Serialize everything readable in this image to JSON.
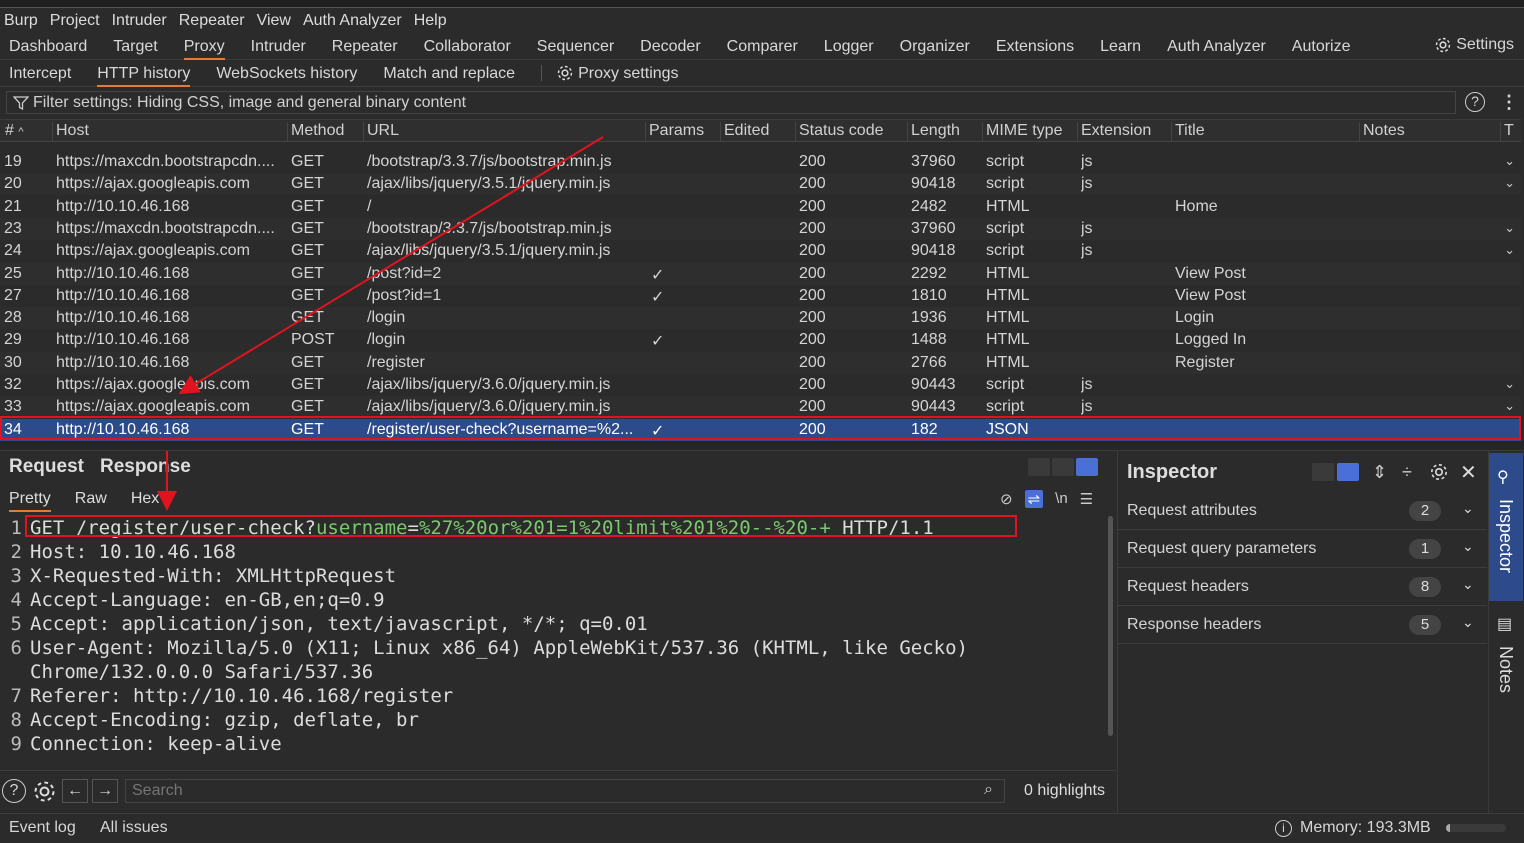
{
  "menubar": [
    "Burp",
    "Project",
    "Intruder",
    "Repeater",
    "View",
    "Auth Analyzer",
    "Help"
  ],
  "main_tabs": [
    "Dashboard",
    "Target",
    "Proxy",
    "Intruder",
    "Repeater",
    "Collaborator",
    "Sequencer",
    "Decoder",
    "Comparer",
    "Logger",
    "Organizer",
    "Extensions",
    "Learn",
    "Auth Analyzer",
    "Autorize"
  ],
  "main_tab_active": "Proxy",
  "settings_label": "Settings",
  "proxy_tabs": [
    "Intercept",
    "HTTP history",
    "WebSockets history",
    "Match and replace"
  ],
  "proxy_settings_label": "Proxy settings",
  "filter_text": "Filter settings: Hiding CSS, image and general binary content",
  "columns": {
    "num": "#",
    "host": "Host",
    "method": "Method",
    "url": "URL",
    "params": "Params",
    "edited": "Edited",
    "status": "Status code",
    "length": "Length",
    "mime": "MIME type",
    "ext": "Extension",
    "title": "Title",
    "notes": "Notes",
    "t": "T"
  },
  "rows": [
    {
      "num": "19",
      "host": "https://maxcdn.bootstrapcdn....",
      "method": "GET",
      "url": "/bootstrap/3.3.7/js/bootstrap.min.js",
      "params": "",
      "status": "200",
      "length": "37960",
      "mime": "script",
      "ext": "js",
      "title": "",
      "chev": true
    },
    {
      "num": "20",
      "host": "https://ajax.googleapis.com",
      "method": "GET",
      "url": "/ajax/libs/jquery/3.5.1/jquery.min.js",
      "params": "",
      "status": "200",
      "length": "90418",
      "mime": "script",
      "ext": "js",
      "title": "",
      "chev": true
    },
    {
      "num": "21",
      "host": "http://10.10.46.168",
      "method": "GET",
      "url": "/",
      "params": "",
      "status": "200",
      "length": "2482",
      "mime": "HTML",
      "ext": "",
      "title": "Home",
      "chev": false
    },
    {
      "num": "23",
      "host": "https://maxcdn.bootstrapcdn....",
      "method": "GET",
      "url": "/bootstrap/3.3.7/js/bootstrap.min.js",
      "params": "",
      "status": "200",
      "length": "37960",
      "mime": "script",
      "ext": "js",
      "title": "",
      "chev": true
    },
    {
      "num": "24",
      "host": "https://ajax.googleapis.com",
      "method": "GET",
      "url": "/ajax/libs/jquery/3.5.1/jquery.min.js",
      "params": "",
      "status": "200",
      "length": "90418",
      "mime": "script",
      "ext": "js",
      "title": "",
      "chev": true
    },
    {
      "num": "25",
      "host": "http://10.10.46.168",
      "method": "GET",
      "url": "/post?id=2",
      "params": "✓",
      "status": "200",
      "length": "2292",
      "mime": "HTML",
      "ext": "",
      "title": "View Post",
      "chev": false
    },
    {
      "num": "27",
      "host": "http://10.10.46.168",
      "method": "GET",
      "url": "/post?id=1",
      "params": "✓",
      "status": "200",
      "length": "1810",
      "mime": "HTML",
      "ext": "",
      "title": "View Post",
      "chev": false
    },
    {
      "num": "28",
      "host": "http://10.10.46.168",
      "method": "GET",
      "url": "/login",
      "params": "",
      "status": "200",
      "length": "1936",
      "mime": "HTML",
      "ext": "",
      "title": "Login",
      "chev": false
    },
    {
      "num": "29",
      "host": "http://10.10.46.168",
      "method": "POST",
      "url": "/login",
      "params": "✓",
      "status": "200",
      "length": "1488",
      "mime": "HTML",
      "ext": "",
      "title": "Logged In",
      "chev": false
    },
    {
      "num": "30",
      "host": "http://10.10.46.168",
      "method": "GET",
      "url": "/register",
      "params": "",
      "status": "200",
      "length": "2766",
      "mime": "HTML",
      "ext": "",
      "title": "Register",
      "chev": false
    },
    {
      "num": "32",
      "host": "https://ajax.googleapis.com",
      "method": "GET",
      "url": "/ajax/libs/jquery/3.6.0/jquery.min.js",
      "params": "",
      "status": "200",
      "length": "90443",
      "mime": "script",
      "ext": "js",
      "title": "",
      "chev": true
    },
    {
      "num": "33",
      "host": "https://ajax.googleapis.com",
      "method": "GET",
      "url": "/ajax/libs/jquery/3.6.0/jquery.min.js",
      "params": "",
      "status": "200",
      "length": "90443",
      "mime": "script",
      "ext": "js",
      "title": "",
      "chev": true
    },
    {
      "num": "34",
      "host": "http://10.10.46.168",
      "method": "GET",
      "url": "/register/user-check?username=%2...",
      "params": "✓",
      "status": "200",
      "length": "182",
      "mime": "JSON",
      "ext": "",
      "title": "",
      "chev": false
    }
  ],
  "selected_row": "34",
  "request_tabs": {
    "request": "Request",
    "response": "Response"
  },
  "view_tabs": {
    "pretty": "Pretty",
    "raw": "Raw",
    "hex": "Hex"
  },
  "request_lines": [
    {
      "n": "1",
      "pre": "GET /register/user-check?",
      "param": "username",
      "eq": "=",
      "val": "%27%20or%201=1%20limit%201%20--%20-+",
      "post": " HTTP/1.1"
    },
    {
      "n": "2",
      "text": "Host: 10.10.46.168"
    },
    {
      "n": "3",
      "text": "X-Requested-With: XMLHttpRequest"
    },
    {
      "n": "4",
      "text": "Accept-Language: en-GB,en;q=0.9"
    },
    {
      "n": "5",
      "text": "Accept: application/json, text/javascript, */*; q=0.01"
    },
    {
      "n": "6",
      "text": "User-Agent: Mozilla/5.0 (X11; Linux x86_64) AppleWebKit/537.36 (KHTML, like Gecko)"
    },
    {
      "n": "",
      "text": "Chrome/132.0.0.0 Safari/537.36"
    },
    {
      "n": "7",
      "text": "Referer: http://10.10.46.168/register"
    },
    {
      "n": "8",
      "text": "Accept-Encoding: gzip, deflate, br"
    },
    {
      "n": "9",
      "text": "Connection: keep-alive"
    }
  ],
  "search_placeholder": "Search",
  "highlights": "0 highlights",
  "inspector": {
    "title": "Inspector",
    "sections": [
      {
        "label": "Request attributes",
        "count": "2"
      },
      {
        "label": "Request query parameters",
        "count": "1"
      },
      {
        "label": "Request headers",
        "count": "8"
      },
      {
        "label": "Response headers",
        "count": "5"
      }
    ]
  },
  "sidebar": {
    "inspector": "Inspector",
    "notes": "Notes"
  },
  "status": {
    "event_log": "Event log",
    "all_issues": "All issues",
    "memory": "Memory: 193.3MB"
  }
}
